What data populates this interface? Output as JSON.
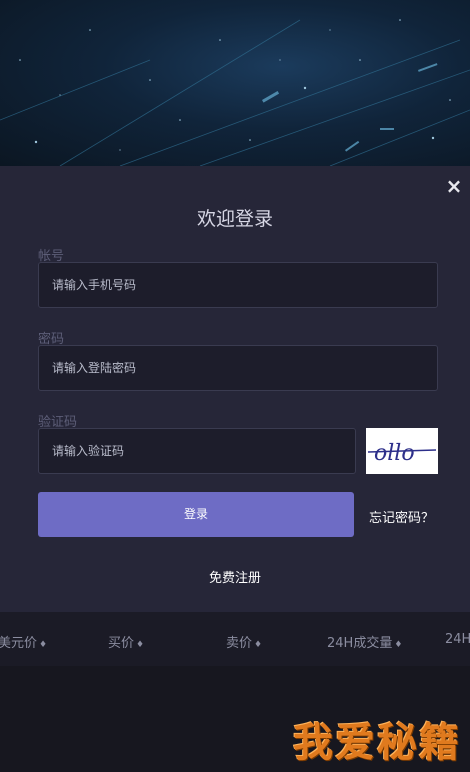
{
  "modal": {
    "title": "欢迎登录",
    "close_icon": "×",
    "account": {
      "label": "帐号",
      "placeholder": "请输入手机号码"
    },
    "password": {
      "label": "密码",
      "placeholder": "请输入登陆密码"
    },
    "captcha": {
      "label": "验证码",
      "placeholder": "请输入验证码",
      "image_text": "ollo"
    },
    "login_button": "登录",
    "forgot_password": "忘记密码？",
    "register": "免费注册"
  },
  "table_header": {
    "columns": [
      {
        "label": "美元价",
        "sort_icon": "♦"
      },
      {
        "label": "买价",
        "sort_icon": "♦"
      },
      {
        "label": "卖价",
        "sort_icon": "♦"
      },
      {
        "label": "24H成交量",
        "sort_icon": "♦"
      },
      {
        "label": "24H"
      }
    ]
  },
  "watermark": "我爱秘籍",
  "colors": {
    "modal_bg": "#262638",
    "input_bg": "#1d1d2b",
    "button_accent": "#6e6cc5",
    "watermark": "#e07a1e"
  }
}
